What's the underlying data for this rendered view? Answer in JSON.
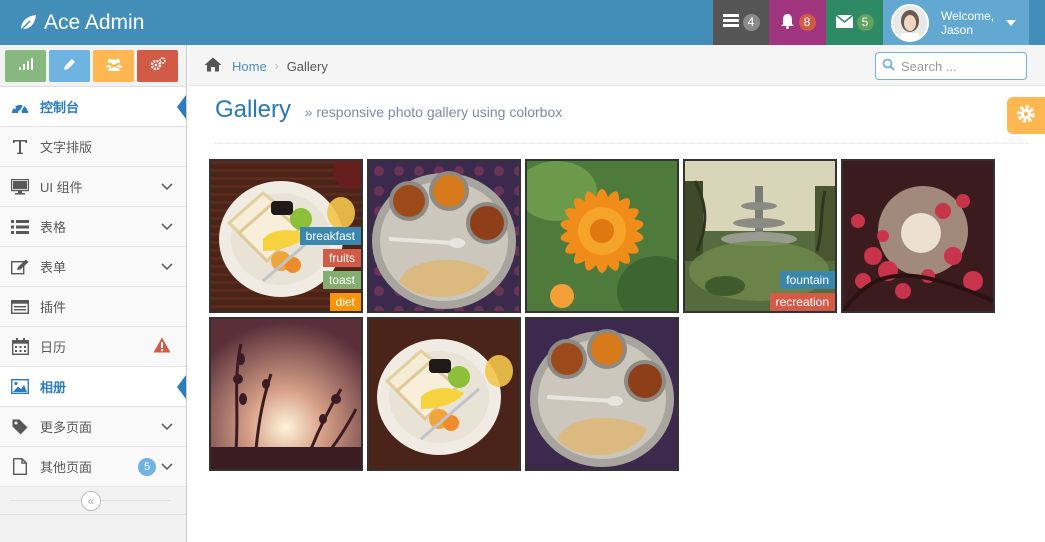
{
  "navbar": {
    "brand": "Ace Admin",
    "tasks_count": "4",
    "notifications_count": "8",
    "messages_count": "5",
    "welcome": "Welcome,",
    "user_name": "Jason",
    "colors": {
      "navbar": "#438eb9",
      "tasks": "#555555",
      "notifications": "#a0357f",
      "messages": "#2e8965",
      "user": "#62a8d1"
    }
  },
  "shortcuts": [
    {
      "icon": "signal-icon",
      "color": "#87b87f"
    },
    {
      "icon": "pencil-icon",
      "color": "#6fb3e0"
    },
    {
      "icon": "users-icon",
      "color": "#ffb752"
    },
    {
      "icon": "cogs-icon",
      "color": "#d15b47"
    }
  ],
  "sidebar": {
    "items": [
      {
        "label": "控制台",
        "icon": "dashboard-icon",
        "active": true
      },
      {
        "label": "文字排版",
        "icon": "text-icon"
      },
      {
        "label": "UI 组件",
        "icon": "desktop-icon",
        "has_submenu": true
      },
      {
        "label": "表格",
        "icon": "list-icon",
        "has_submenu": true
      },
      {
        "label": "表单",
        "icon": "edit-icon",
        "has_submenu": true
      },
      {
        "label": "插件",
        "icon": "widget-icon"
      },
      {
        "label": "日历",
        "icon": "calendar-icon",
        "alert_icon": "warning-icon"
      },
      {
        "label": "相册",
        "icon": "picture-icon",
        "active": true
      },
      {
        "label": "更多页面",
        "icon": "tag-icon",
        "has_submenu": true
      },
      {
        "label": "其他页面",
        "icon": "file-icon",
        "badge": "5",
        "has_submenu": true
      }
    ]
  },
  "breadcrumb": {
    "home": "Home",
    "current": "Gallery"
  },
  "search": {
    "placeholder": "Search ..."
  },
  "page_header": {
    "title": "Gallery",
    "subtitle": "» responsive photo gallery using colorbox"
  },
  "gallery": {
    "images": [
      {
        "subject": "breakfast plate",
        "tags": [
          "breakfast",
          "fruits",
          "toast",
          "diet"
        ]
      },
      {
        "subject": "thali plate",
        "tags": []
      },
      {
        "subject": "orange flower",
        "tags": []
      },
      {
        "subject": "garden fountain",
        "tags": [
          "fountain",
          "recreation"
        ]
      },
      {
        "subject": "red bougainvillea",
        "tags": []
      },
      {
        "subject": "sunset silhouette",
        "tags": []
      },
      {
        "subject": "breakfast plate",
        "tags": []
      },
      {
        "subject": "thali plate",
        "tags": []
      }
    ]
  }
}
